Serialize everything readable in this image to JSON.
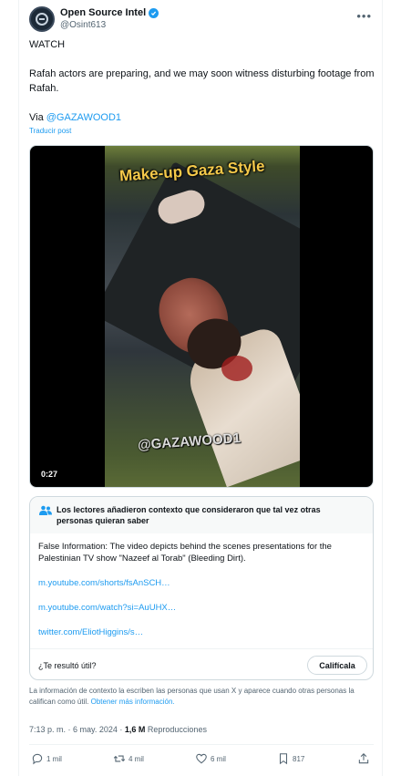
{
  "author": {
    "display_name": "Open Source Intel",
    "handle": "@Osint613",
    "verified": true,
    "more_glyph": "•••"
  },
  "tweet": {
    "line1": "WATCH",
    "line2": "Rafah actors are preparing, and we may soon witness disturbing footage from Rafah.",
    "via_prefix": "Via ",
    "via_handle": "@GAZAWOOD1",
    "translate_label": "Traducir post"
  },
  "media": {
    "overlay_title": "Make-up Gaza Style",
    "watermark": "@GAZAWOOD1",
    "duration": "0:27"
  },
  "community_note": {
    "header": "Los lectores añadieron contexto que consideraron que tal vez otras personas quieran saber",
    "body": "False Information: The video depicts behind the scenes presentations for the Palestinian TV show \"Nazeef al Torab\" (Bleeding Dirt).",
    "links": [
      "m.youtube.com/shorts/fsAnSCH…",
      "m.youtube.com/watch?si=AuUHX…",
      "twitter.com/EliotHiggins/s…"
    ],
    "helpful_question": "¿Te resultó útil?",
    "rate_button": "Califícala"
  },
  "disclaimer": {
    "text": "La información de contexto la escriben las personas que usan X y aparece cuando otras personas la califican como útil. ",
    "link": "Obtener más información."
  },
  "meta": {
    "timestamp": "7:13 p. m. · 6 may. 2024 · ",
    "views_count": "1,6 M",
    "views_label": " Reproducciones"
  },
  "actions": {
    "replies": "1 mil",
    "reposts": "4 mil",
    "likes": "6 mil",
    "bookmarks": "817"
  },
  "colors": {
    "accent": "#1d9bf0",
    "text": "#0f1419",
    "secondary": "#536471",
    "overlay_title": "#f5c94a"
  }
}
